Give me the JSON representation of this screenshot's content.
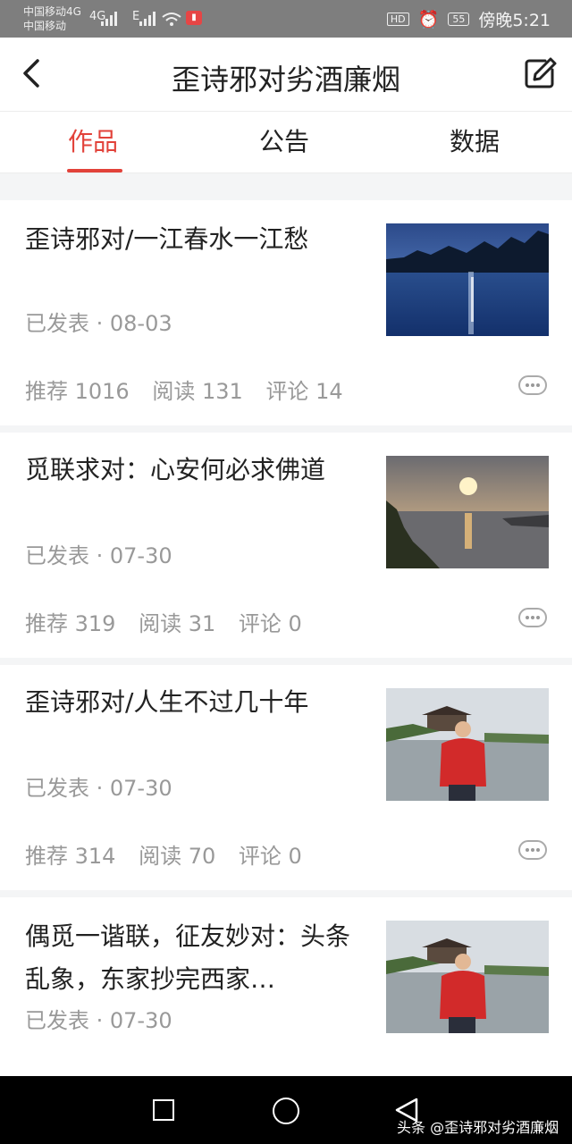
{
  "status_bar": {
    "carrier_line1": "中国移动4G",
    "carrier_line2": "中国移动",
    "signal1_label": "4G",
    "signal2_label": "E",
    "battery": "55",
    "time": "傍晚5:21"
  },
  "header": {
    "title": "歪诗邪对劣酒廉烟"
  },
  "tabs": [
    {
      "label": "作品"
    },
    {
      "label": "公告"
    },
    {
      "label": "数据"
    }
  ],
  "articles": [
    {
      "title": "歪诗邪对/一江春水一江愁",
      "status": "已发表 · 08-03",
      "recommend": "推荐 1016",
      "read": "阅读 131",
      "comment": "评论 14"
    },
    {
      "title": "觅联求对：心安何必求佛道",
      "status": "已发表 · 07-30",
      "recommend": "推荐 319",
      "read": "阅读 31",
      "comment": "评论 0"
    },
    {
      "title": "歪诗邪对/人生不过几十年",
      "status": "已发表 · 07-30",
      "recommend": "推荐 314",
      "read": "阅读 70",
      "comment": "评论 0"
    },
    {
      "title": "偶觅一谐联，征友妙对：头条乱象，东家抄完西家…",
      "status": "已发表 · 07-30"
    }
  ],
  "watermark": "头条 @歪诗邪对劣酒廉烟",
  "colors": {
    "accent": "#e2423a"
  }
}
